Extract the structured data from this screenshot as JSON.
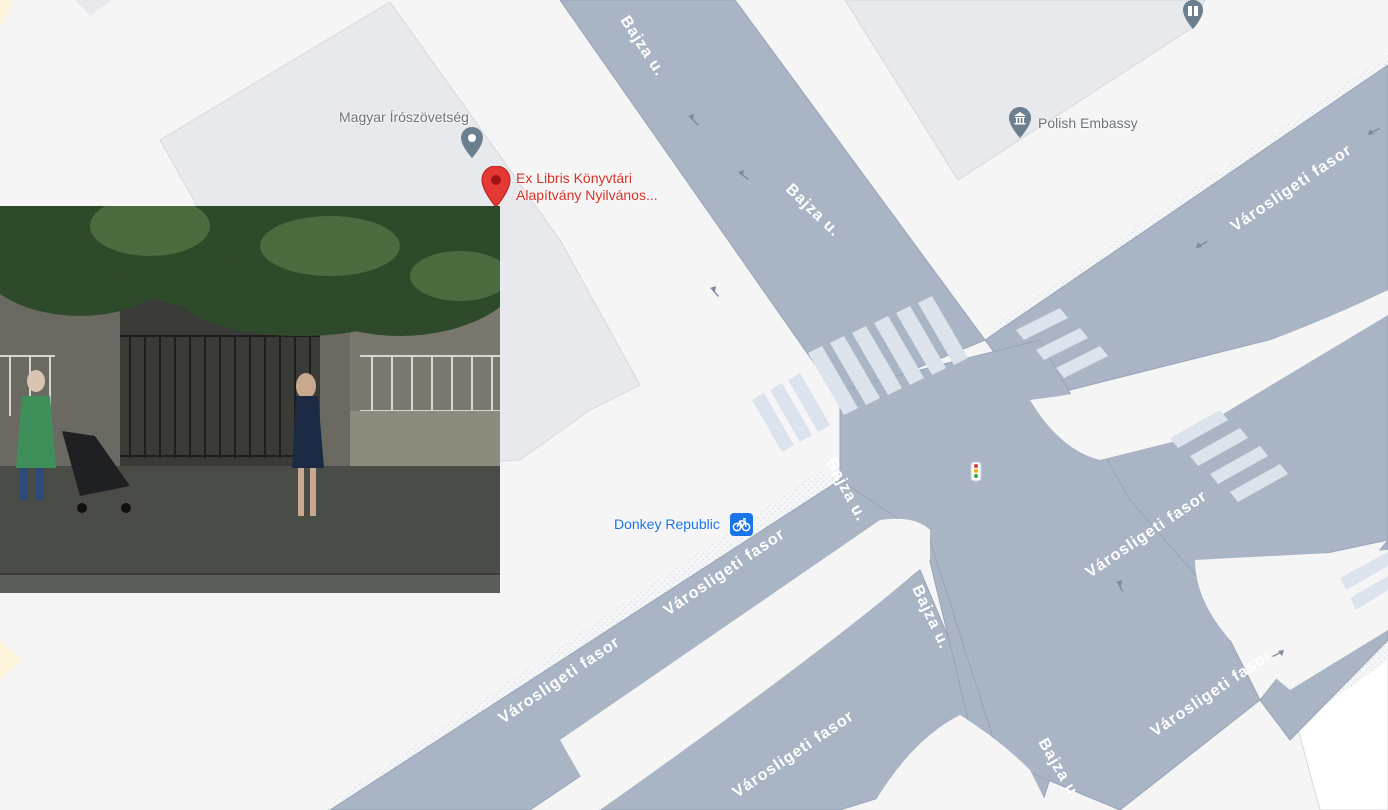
{
  "roads": {
    "bajza_labels": [
      "Bajza u.",
      "Bajza u.",
      "Bajza u.",
      "Bajza u.",
      "Bajza u."
    ],
    "varosligeti_labels": [
      "Városligeti fasor",
      "Városligeti fasor",
      "Városligeti fasor",
      "Városligeti fasor",
      "Városligeti fasor",
      "Városligeti fasor"
    ]
  },
  "places": {
    "writers_union": {
      "name": "Magyar Írószövetség",
      "icon": "place-pin-icon"
    },
    "selected": {
      "name_line1": "Ex Libris Könyvtári",
      "name_line2": "Alapítvány Nyilvános...",
      "icon": "red-marker-icon"
    },
    "embassy": {
      "name": "Polish Embassy",
      "icon": "embassy-icon"
    },
    "bike_share": {
      "name": "Donkey Republic",
      "icon": "bicycle-icon"
    },
    "top_library": {
      "icon": "library-book-icon"
    },
    "traffic_signal": {
      "icon": "traffic-light-icon"
    }
  },
  "street_view": {
    "icon": "street-view-thumbnail"
  },
  "colors": {
    "road": "#a9b5c5",
    "background": "#f5f5f6",
    "building": "#e8e9ed",
    "marker": "#e53935",
    "poi_gray": "#6c757a",
    "poi_red": "#d93025",
    "transit_blue": "#1a73e8"
  }
}
